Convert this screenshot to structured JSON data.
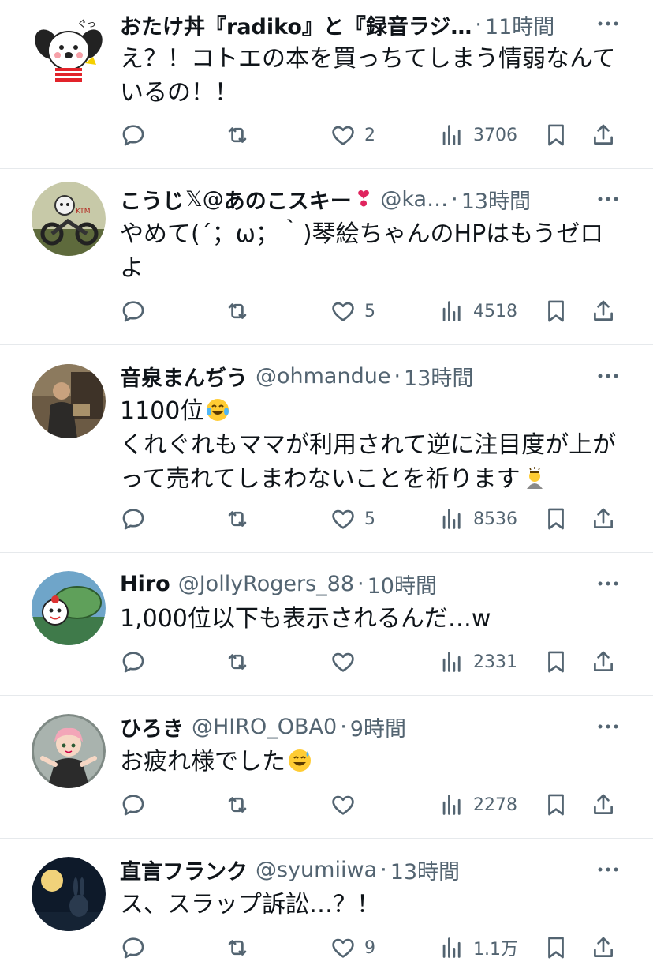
{
  "tweets": [
    {
      "name": "おたけ丼『radiko』と『録音ラジ…",
      "handle": "",
      "time": "11時間",
      "text": "え？！コトエの本を買っちてしまう情弱なんているの！！",
      "emoji": "",
      "replies": "",
      "retweets": "",
      "likes": "2",
      "views": "3706",
      "avatar_icon": "cartoon-dog-avatar"
    },
    {
      "name": "こうじ",
      "badge": "𝕏@",
      "name_suffix": "あのこスキー",
      "heart": "❣",
      "handle": "@ka…",
      "time": "13時間",
      "text": "やめて(´；ω；｀)琴絵ちゃんのHPはもうゼロよ",
      "emoji": "",
      "replies": "",
      "retweets": "",
      "likes": "5",
      "views": "4518",
      "avatar_icon": "motorcycle-avatar"
    },
    {
      "name": "音泉まんぢう",
      "handle": "@ohmandue",
      "time": "13時間",
      "text_line1": "1100位",
      "text": "くれぐれもママが利用されて逆に注目度が上がって売れてしまわないことを祈ります",
      "emoji": "laughing-tears-emoji",
      "replies": "",
      "retweets": "",
      "likes": "5",
      "views": "8536",
      "avatar_icon": "person-photo-avatar"
    },
    {
      "name": "Hiro",
      "handle": "@JollyRogers_88",
      "time": "10時間",
      "text": "1,000位以下も表示されるんだ…w",
      "emoji": "",
      "replies": "",
      "retweets": "",
      "likes": "",
      "views": "2331",
      "avatar_icon": "mascot-avatar"
    },
    {
      "name": "ひろき",
      "handle": "@HIRO_OBA0",
      "time": "9時間",
      "text": "お疲れ様でした",
      "emoji": "sweat-smile-emoji",
      "replies": "",
      "retweets": "",
      "likes": "",
      "views": "2278",
      "avatar_icon": "anime-girl-avatar"
    },
    {
      "name": "直言フランク",
      "handle": "@syumiiwa",
      "time": "13時間",
      "text": "ス、スラップ訴訟…？！",
      "emoji": "",
      "replies": "",
      "retweets": "",
      "likes": "9",
      "views": "1.1万",
      "avatar_icon": "rabbit-moon-avatar"
    }
  ],
  "colors": {
    "text": "#0f1419",
    "muted": "#536471",
    "divider": "#e6e9ec",
    "heart_badge": "#e0245e"
  }
}
